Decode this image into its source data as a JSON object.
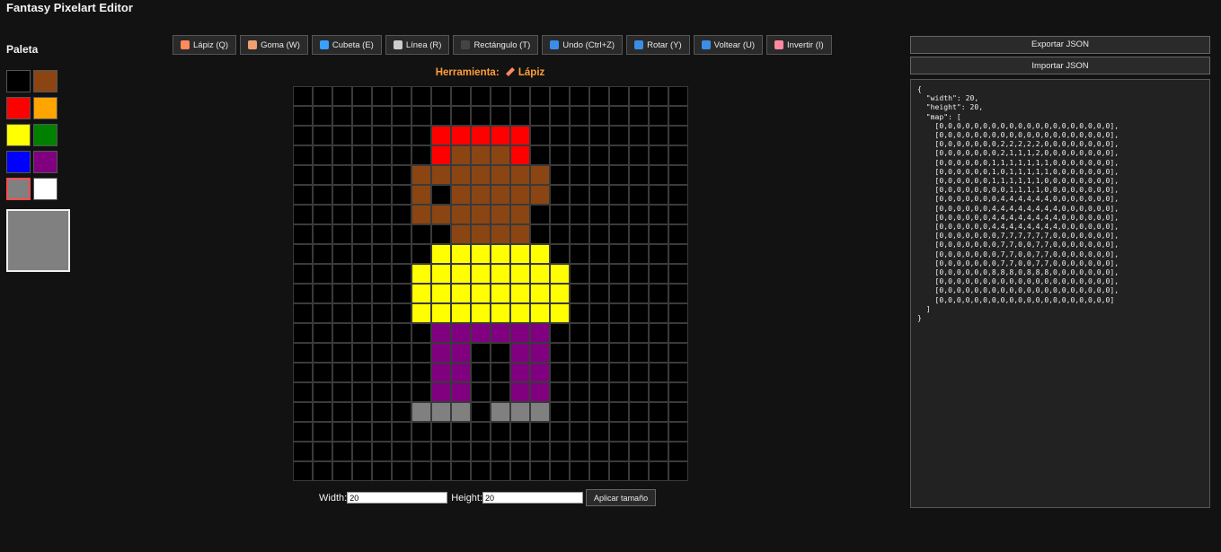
{
  "app": {
    "title": "Fantasy Pixelart Editor"
  },
  "palette": {
    "title": "Paleta",
    "colors": [
      "#000000",
      "#8B4513",
      "#FF0000",
      "#FFA500",
      "#FFFF00",
      "#008000",
      "#0000FF",
      "#800080",
      "#808080",
      "#FFFFFF"
    ],
    "selected_index": 8,
    "current_color": "#808080"
  },
  "toolbar": [
    {
      "label": "Lápiz (Q)",
      "icon": "pencil-icon",
      "color": "#ff8a5c"
    },
    {
      "label": "Goma (W)",
      "icon": "eraser-icon",
      "color": "#f0a070"
    },
    {
      "label": "Cubeta (E)",
      "icon": "bucket-icon",
      "color": "#3aa0ff"
    },
    {
      "label": "Línea (R)",
      "icon": "line-icon",
      "color": "#cccccc"
    },
    {
      "label": "Rectángulo (T)",
      "icon": "rectangle-icon",
      "color": "#444444"
    },
    {
      "label": "Undo (Ctrl+Z)",
      "icon": "undo-icon",
      "color": "#3a8ee8"
    },
    {
      "label": "Rotar (Y)",
      "icon": "rotate-icon",
      "color": "#3a8ee8"
    },
    {
      "label": "Voltear (U)",
      "icon": "flip-icon",
      "color": "#3a8ee8"
    },
    {
      "label": "Invertir (I)",
      "icon": "invert-icon",
      "color": "#ff8aa0"
    }
  ],
  "tool_indicator": {
    "prefix": "Herramienta:",
    "tool": "Lápiz"
  },
  "canvas": {
    "width": 20,
    "height": 20,
    "map": [
      [
        0,
        0,
        0,
        0,
        0,
        0,
        0,
        0,
        0,
        0,
        0,
        0,
        0,
        0,
        0,
        0,
        0,
        0,
        0,
        0
      ],
      [
        0,
        0,
        0,
        0,
        0,
        0,
        0,
        0,
        0,
        0,
        0,
        0,
        0,
        0,
        0,
        0,
        0,
        0,
        0,
        0
      ],
      [
        0,
        0,
        0,
        0,
        0,
        0,
        0,
        2,
        2,
        2,
        2,
        2,
        0,
        0,
        0,
        0,
        0,
        0,
        0,
        0
      ],
      [
        0,
        0,
        0,
        0,
        0,
        0,
        0,
        2,
        1,
        1,
        1,
        2,
        0,
        0,
        0,
        0,
        0,
        0,
        0,
        0
      ],
      [
        0,
        0,
        0,
        0,
        0,
        0,
        1,
        1,
        1,
        1,
        1,
        1,
        1,
        0,
        0,
        0,
        0,
        0,
        0,
        0
      ],
      [
        0,
        0,
        0,
        0,
        0,
        0,
        1,
        0,
        1,
        1,
        1,
        1,
        1,
        0,
        0,
        0,
        0,
        0,
        0,
        0
      ],
      [
        0,
        0,
        0,
        0,
        0,
        0,
        1,
        1,
        1,
        1,
        1,
        1,
        0,
        0,
        0,
        0,
        0,
        0,
        0,
        0
      ],
      [
        0,
        0,
        0,
        0,
        0,
        0,
        0,
        0,
        1,
        1,
        1,
        1,
        0,
        0,
        0,
        0,
        0,
        0,
        0,
        0
      ],
      [
        0,
        0,
        0,
        0,
        0,
        0,
        0,
        4,
        4,
        4,
        4,
        4,
        4,
        0,
        0,
        0,
        0,
        0,
        0,
        0
      ],
      [
        0,
        0,
        0,
        0,
        0,
        0,
        4,
        4,
        4,
        4,
        4,
        4,
        4,
        4,
        0,
        0,
        0,
        0,
        0,
        0
      ],
      [
        0,
        0,
        0,
        0,
        0,
        0,
        4,
        4,
        4,
        4,
        4,
        4,
        4,
        4,
        0,
        0,
        0,
        0,
        0,
        0
      ],
      [
        0,
        0,
        0,
        0,
        0,
        0,
        4,
        4,
        4,
        4,
        4,
        4,
        4,
        4,
        0,
        0,
        0,
        0,
        0,
        0
      ],
      [
        0,
        0,
        0,
        0,
        0,
        0,
        0,
        7,
        7,
        7,
        7,
        7,
        7,
        0,
        0,
        0,
        0,
        0,
        0,
        0
      ],
      [
        0,
        0,
        0,
        0,
        0,
        0,
        0,
        7,
        7,
        0,
        0,
        7,
        7,
        0,
        0,
        0,
        0,
        0,
        0,
        0
      ],
      [
        0,
        0,
        0,
        0,
        0,
        0,
        0,
        7,
        7,
        0,
        0,
        7,
        7,
        0,
        0,
        0,
        0,
        0,
        0,
        0
      ],
      [
        0,
        0,
        0,
        0,
        0,
        0,
        0,
        7,
        7,
        0,
        0,
        7,
        7,
        0,
        0,
        0,
        0,
        0,
        0,
        0
      ],
      [
        0,
        0,
        0,
        0,
        0,
        0,
        8,
        8,
        8,
        0,
        8,
        8,
        8,
        0,
        0,
        0,
        0,
        0,
        0,
        0
      ],
      [
        0,
        0,
        0,
        0,
        0,
        0,
        0,
        0,
        0,
        0,
        0,
        0,
        0,
        0,
        0,
        0,
        0,
        0,
        0,
        0
      ],
      [
        0,
        0,
        0,
        0,
        0,
        0,
        0,
        0,
        0,
        0,
        0,
        0,
        0,
        0,
        0,
        0,
        0,
        0,
        0,
        0
      ],
      [
        0,
        0,
        0,
        0,
        0,
        0,
        0,
        0,
        0,
        0,
        0,
        0,
        0,
        0,
        0,
        0,
        0,
        0,
        0,
        0
      ]
    ]
  },
  "size": {
    "width_label": "Width:",
    "width_value": "20",
    "height_label": "Height:",
    "height_value": "20",
    "apply_label": "Aplicar tamaño"
  },
  "json_panel": {
    "export_label": "Exportar JSON",
    "import_label": "Importar JSON"
  }
}
